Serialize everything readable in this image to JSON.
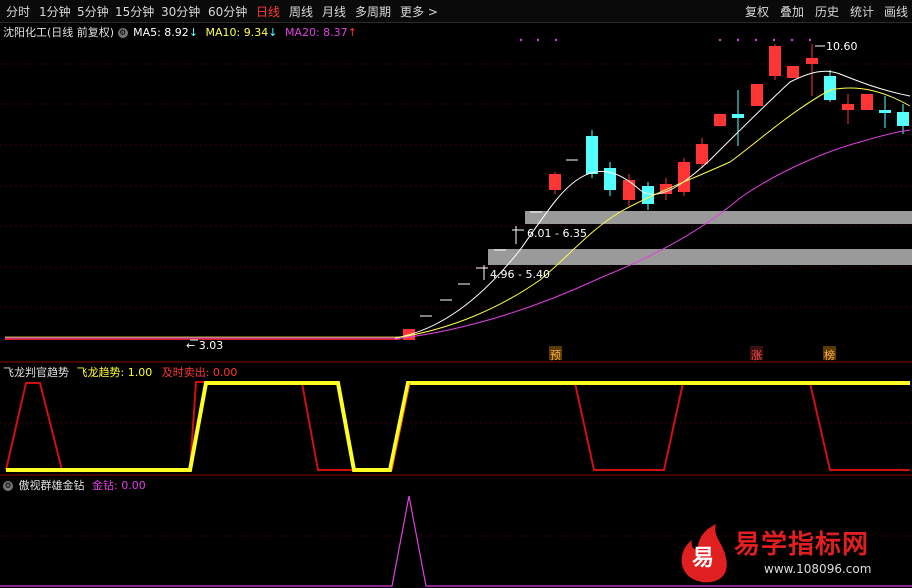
{
  "toolbar": {
    "periods": [
      "分时",
      "1分钟",
      "5分钟",
      "15分钟",
      "30分钟",
      "60分钟",
      "日线",
      "周线",
      "月线",
      "多周期",
      "更多"
    ],
    "active": "日线",
    "right": [
      "复权",
      "叠加",
      "历史",
      "统计",
      "画线"
    ]
  },
  "main": {
    "stock": "沈阳化工",
    "mode": "(日线 前复权)",
    "ma5_label": "MA5: 8.92",
    "ma10_label": "MA10: 9.34",
    "ma20_label": "MA20: 8.37",
    "ma5_arrow": "↓",
    "ma10_arrow": "↓",
    "ma20_arrow": "↑",
    "high_label": "10.60",
    "low_label": "3.03",
    "zone1_label": "6.01 - 6.35",
    "zone2_label": "4.96 - 5.40",
    "markers": [
      "预",
      "涨",
      "榜"
    ]
  },
  "panel2": {
    "title": "飞龙判官趋势",
    "trend_label": "飞龙趋势: 1.00",
    "sell_label": "及时卖出: 0.00"
  },
  "panel3": {
    "title": "傲视群雄金钻",
    "gold_label": "金钻: 0.00"
  },
  "watermark": {
    "logo_char": "易",
    "brand": "易学指标网",
    "url": "www.108096.com"
  },
  "colors": {
    "up": "#ff3535",
    "down": "#54ffff",
    "ma5": "#ffffff",
    "ma10": "#ffff4a",
    "ma20": "#e040e0",
    "trend": "#ffff22",
    "sell": "#d01010"
  },
  "chart_data": {
    "type": "candlestick",
    "high": 10.6,
    "low": 3.03,
    "ma": {
      "ma5": 8.92,
      "ma10": 9.34,
      "ma20": 8.37
    },
    "resistance_zones": [
      [
        6.01,
        6.35
      ],
      [
        4.96,
        5.4
      ]
    ]
  }
}
